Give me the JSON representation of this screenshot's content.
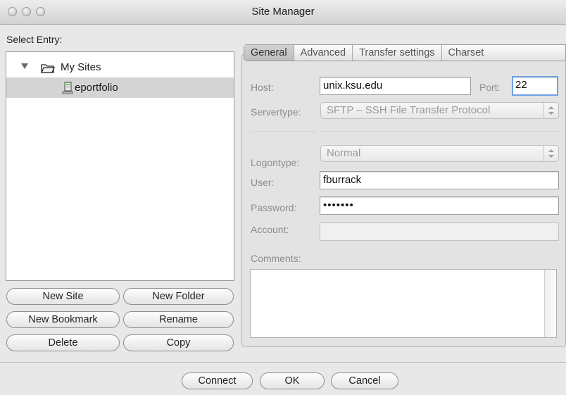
{
  "window": {
    "title": "Site Manager"
  },
  "left": {
    "select_entry_label": "Select Entry:",
    "tree": [
      {
        "label": "My Sites",
        "icon": "folder-icon"
      },
      {
        "label": "eportfolio",
        "icon": "server-icon",
        "selected": true
      }
    ],
    "buttons": {
      "new_site": "New Site",
      "new_folder": "New Folder",
      "new_bookmark": "New Bookmark",
      "rename": "Rename",
      "delete": "Delete",
      "copy": "Copy"
    }
  },
  "tabs": [
    "General",
    "Advanced",
    "Transfer settings",
    "Charset"
  ],
  "active_tab": "General",
  "general": {
    "host_label": "Host:",
    "host_value": "unix.ksu.edu",
    "port_label": "Port:",
    "port_value": "22",
    "servertype_label": "Servertype:",
    "servertype_value": "SFTP – SSH File Transfer Protocol",
    "logontype_label": "Logontype:",
    "logontype_value": "Normal",
    "user_label": "User:",
    "user_value": "fburrack",
    "password_label": "Password:",
    "password_value": "•••••••",
    "account_label": "Account:",
    "account_value": "",
    "comments_label": "Comments:"
  },
  "footer": {
    "connect": "Connect",
    "ok": "OK",
    "cancel": "Cancel"
  }
}
